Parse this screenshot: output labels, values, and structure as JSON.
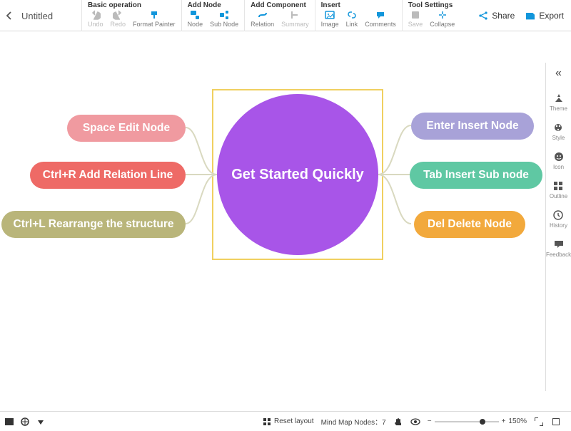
{
  "header": {
    "title": "Untitled",
    "groups": [
      {
        "label": "Basic operation",
        "items": [
          "Undo",
          "Redo",
          "Format Painter"
        ]
      },
      {
        "label": "Add Node",
        "items": [
          "Node",
          "Sub Node"
        ]
      },
      {
        "label": "Add Component",
        "items": [
          "Relation",
          "Summary"
        ]
      },
      {
        "label": "Insert",
        "items": [
          "Image",
          "Link",
          "Comments"
        ]
      },
      {
        "label": "Tool Settings",
        "items": [
          "Save",
          "Collapse"
        ]
      }
    ],
    "share": "Share",
    "export": "Export"
  },
  "sidebar": {
    "items": [
      "Theme",
      "Style",
      "Icon",
      "Outline",
      "History",
      "Feedback"
    ]
  },
  "mindmap": {
    "center": "Get Started Quickly",
    "right": [
      {
        "label": "Enter Insert Node",
        "color": "#a8a2d8"
      },
      {
        "label": "Tab Insert Sub node",
        "color": "#5fc8a3"
      },
      {
        "label": "Del Delete Node",
        "color": "#f2a93c"
      }
    ],
    "left": [
      {
        "label": "Space Edit Node",
        "color": "#f09aa0"
      },
      {
        "label": "Ctrl+R Add Relation Line",
        "color": "#ee6a66"
      },
      {
        "label": "Ctrl+L Rearrange the structure",
        "color": "#b9b57a"
      }
    ]
  },
  "footer": {
    "reset": "Reset layout",
    "nodes_label": "Mind Map Nodes：",
    "nodes_count": "7",
    "zoom_minus": "−",
    "zoom_plus": "+",
    "zoom_value": "150%"
  }
}
